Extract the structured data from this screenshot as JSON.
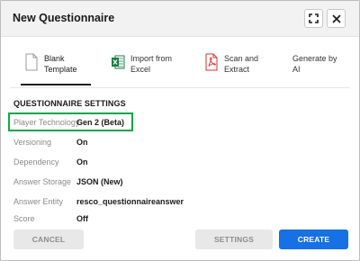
{
  "dialog": {
    "title": "New Questionnaire"
  },
  "header_buttons": {
    "expand_icon": "expand-icon",
    "close_icon": "close-icon"
  },
  "tabs": [
    {
      "label": "Blank\nTemplate",
      "icon": "blank-document-icon",
      "selected": true
    },
    {
      "label": "Import from\nExcel",
      "icon": "excel-icon",
      "selected": false
    },
    {
      "label": "Scan and\nExtract",
      "icon": "pdf-icon",
      "selected": false
    },
    {
      "label": "Generate by\nAI",
      "icon": "none",
      "selected": false
    }
  ],
  "settings": {
    "section_title": "QUESTIONNAIRE SETTINGS",
    "rows": [
      {
        "label": "Player Technology",
        "value": "Gen 2 (Beta)"
      },
      {
        "label": "Versioning",
        "value": "On"
      },
      {
        "label": "Dependency",
        "value": "On"
      },
      {
        "label": "Answer Storage",
        "value": "JSON (New)"
      },
      {
        "label": "Answer Entity",
        "value": "resco_questionnaireanswer"
      },
      {
        "label": "Score",
        "value": "Off"
      }
    ]
  },
  "footer": {
    "cancel_label": "CANCEL",
    "settings_label": "SETTINGS",
    "create_label": "CREATE"
  },
  "colors": {
    "accent": "#1670e6",
    "highlight": "#1aa34a",
    "excel_green": "#1e7b45",
    "pdf_red": "#d9302c"
  }
}
